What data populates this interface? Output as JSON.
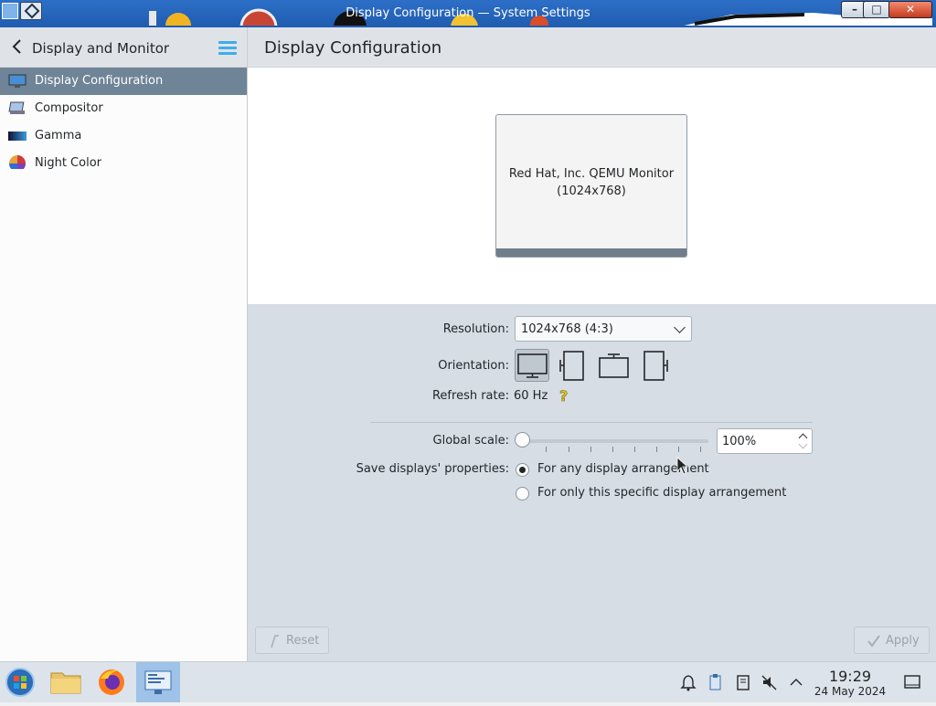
{
  "window": {
    "title": "Display Configuration — System Settings",
    "controls": {
      "minimize": "–",
      "maximize": "□",
      "close": "✕"
    }
  },
  "sidebar": {
    "header": "Display and Monitor",
    "items": [
      {
        "label": "Display Configuration",
        "icon": "display-config-icon",
        "active": true
      },
      {
        "label": "Compositor",
        "icon": "compositor-icon"
      },
      {
        "label": "Gamma",
        "icon": "gamma-icon"
      },
      {
        "label": "Night Color",
        "icon": "night-color-icon"
      }
    ]
  },
  "main": {
    "title": "Display Configuration",
    "monitor": {
      "name": "Red Hat, Inc. QEMU Monitor",
      "resolution": "(1024x768)"
    },
    "resolution": {
      "label": "Resolution:",
      "value": "1024x768 (4:3)"
    },
    "orientation": {
      "label": "Orientation:",
      "options": [
        "landscape",
        "portrait-left",
        "landscape-flipped",
        "portrait-right"
      ],
      "selected": "landscape"
    },
    "refresh": {
      "label": "Refresh rate:",
      "value": "60 Hz"
    },
    "scale": {
      "label": "Global scale:",
      "value": "100%",
      "slider_level": 0
    },
    "save": {
      "label": "Save displays' properties:",
      "options": [
        "For any display arrangement",
        "For only this specific display arrangement"
      ],
      "selected": 0
    },
    "buttons": {
      "reset": "Reset",
      "apply": "Apply"
    }
  },
  "taskbar": {
    "apps": [
      "start-menu-icon",
      "file-manager-icon",
      "firefox-icon",
      "system-settings-icon"
    ],
    "tray": [
      "notifications-icon",
      "clipboard-icon",
      "storage-icon",
      "volume-muted-icon",
      "tray-expand-icon"
    ],
    "time": "19:29",
    "date": "24 May 2024"
  },
  "colors": {
    "accent": "#3daee9",
    "selection": "#6f8496",
    "titlebar": "#1f5cb0"
  }
}
